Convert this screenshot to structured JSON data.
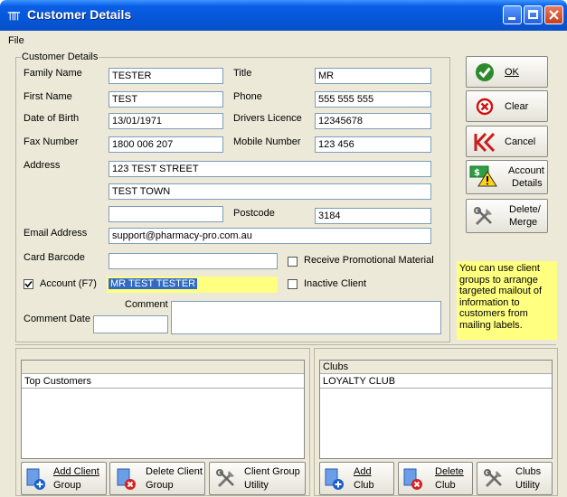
{
  "window": {
    "title": "Customer Details"
  },
  "menu": {
    "file": "File"
  },
  "customer_details": {
    "group_title": "Customer Details",
    "family_name": {
      "label": "Family Name",
      "value": "TESTER"
    },
    "title": {
      "label": "Title",
      "value": "MR"
    },
    "first_name": {
      "label": "First Name",
      "value": "TEST"
    },
    "phone": {
      "label": "Phone",
      "value": "555 555 555"
    },
    "dob": {
      "label": "Date of Birth",
      "value": "13/01/1971"
    },
    "licence": {
      "label": "Drivers Licence",
      "value": "12345678"
    },
    "fax": {
      "label": "Fax Number",
      "value": "1800 006 207"
    },
    "mobile": {
      "label": "Mobile Number",
      "value": "123 456"
    },
    "address": {
      "label": "Address",
      "line1": "123 TEST STREET",
      "line2": "TEST TOWN",
      "line3": ""
    },
    "postcode": {
      "label": "Postcode",
      "value": "3184"
    },
    "email": {
      "label": "Email Address",
      "value": "support@pharmacy-pro.com.au"
    },
    "card_barcode": {
      "label": "Card Barcode",
      "value": ""
    },
    "promo": {
      "label": "Receive Promotional Material",
      "checked": false
    },
    "account": {
      "label": "Account (F7)",
      "value": "MR TEST TESTER",
      "checked": true
    },
    "inactive": {
      "label": "Inactive Client",
      "checked": false
    },
    "comment": {
      "label": "Comment",
      "value": ""
    },
    "comment_date": {
      "label": "Comment Date",
      "value": ""
    }
  },
  "buttons": {
    "ok": "OK",
    "clear": "Clear",
    "cancel": "Cancel",
    "account_details_1": "Account",
    "account_details_2": "Details",
    "delete_merge_1": "Delete/",
    "delete_merge_2": "Merge"
  },
  "note": "You can use client groups to arrange targeted mailout of information to customers from mailing labels.",
  "client_groups": {
    "header": "",
    "items": [
      "Top Customers"
    ],
    "add_1": "Add Client",
    "add_2": "Group",
    "delete_1": "Delete Client",
    "delete_2": "Group",
    "utility_1": "Client Group",
    "utility_2": "Utility"
  },
  "clubs": {
    "header": "Clubs",
    "items": [
      "LOYALTY CLUB"
    ],
    "add_1": "Add",
    "add_2": "Club",
    "delete_1": "Delete",
    "delete_2": "Club",
    "utility_1": "Clubs",
    "utility_2": "Utility"
  },
  "colors": {
    "titlebar": "#0556d8",
    "window_bg": "#ece9d8",
    "note_bg": "#ffff80",
    "selection": "#316ac5"
  }
}
